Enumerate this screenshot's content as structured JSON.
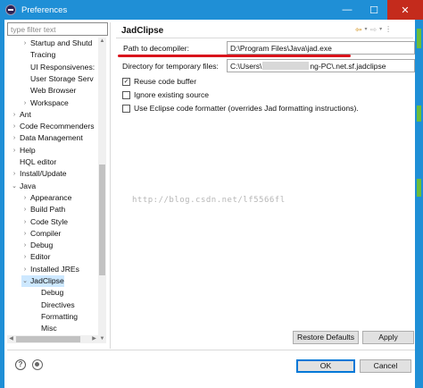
{
  "window": {
    "title": "Preferences",
    "minimize_glyph": "—",
    "maximize_glyph": "☐",
    "close_glyph": "✕"
  },
  "filter": {
    "placeholder": "type filter text",
    "value": ""
  },
  "tree": {
    "items": [
      {
        "label": "Startup and Shutd",
        "twisty": "›"
      },
      {
        "label": "Tracing",
        "twisty": ""
      },
      {
        "label": "UI Responsivenes:",
        "twisty": ""
      },
      {
        "label": "User Storage Serv",
        "twisty": ""
      },
      {
        "label": "Web Browser",
        "twisty": ""
      },
      {
        "label": "Workspace",
        "twisty": "›"
      },
      {
        "label": "Ant",
        "twisty": "›"
      },
      {
        "label": "Code Recommenders",
        "twisty": "›"
      },
      {
        "label": "Data Management",
        "twisty": "›"
      },
      {
        "label": "Help",
        "twisty": "›"
      },
      {
        "label": "HQL editor",
        "twisty": ""
      },
      {
        "label": "Install/Update",
        "twisty": "›"
      },
      {
        "label": "Java",
        "twisty": "⌄"
      },
      {
        "label": "Appearance",
        "twisty": "›"
      },
      {
        "label": "Build Path",
        "twisty": "›"
      },
      {
        "label": "Code Style",
        "twisty": "›"
      },
      {
        "label": "Compiler",
        "twisty": "›"
      },
      {
        "label": "Debug",
        "twisty": "›"
      },
      {
        "label": "Editor",
        "twisty": "›"
      },
      {
        "label": "Installed JREs",
        "twisty": "›"
      },
      {
        "label": "JadClipse",
        "twisty": "⌄",
        "selected": true
      },
      {
        "label": "Debug",
        "twisty": ""
      },
      {
        "label": "Directives",
        "twisty": ""
      },
      {
        "label": "Formatting",
        "twisty": ""
      },
      {
        "label": "Misc",
        "twisty": ""
      }
    ]
  },
  "page": {
    "title": "JadClipse",
    "nav": {
      "back": "⇦",
      "back_dd": "▾",
      "forward": "⇨",
      "forward_dd": "▾",
      "menu": "⋮"
    },
    "decompiler_label": "Path to decompiler:",
    "decompiler_value": "D:\\Program Files\\Java\\jad.exe",
    "tempdir_label": "Directory for temporary files:",
    "tempdir_prefix": "C:\\Users\\",
    "tempdir_suffix": "ng-PC\\.net.sf.jadclipse",
    "checkboxes": [
      {
        "label": "Reuse code buffer",
        "checked": true
      },
      {
        "label": "Ignore existing source",
        "checked": false
      },
      {
        "label": "Use Eclipse code formatter (overrides Jad formatting instructions).",
        "checked": false
      }
    ],
    "watermark": "http://blog.csdn.net/lf5566fl",
    "restore_defaults": "Restore Defaults",
    "apply": "Apply"
  },
  "footer": {
    "help_icon": "?",
    "ok": "OK",
    "cancel": "Cancel"
  },
  "colors": {
    "titlebar": "#1f8fd6",
    "selection": "#cde8ff",
    "underline": "#d9131b",
    "close": "#c42b1c"
  }
}
